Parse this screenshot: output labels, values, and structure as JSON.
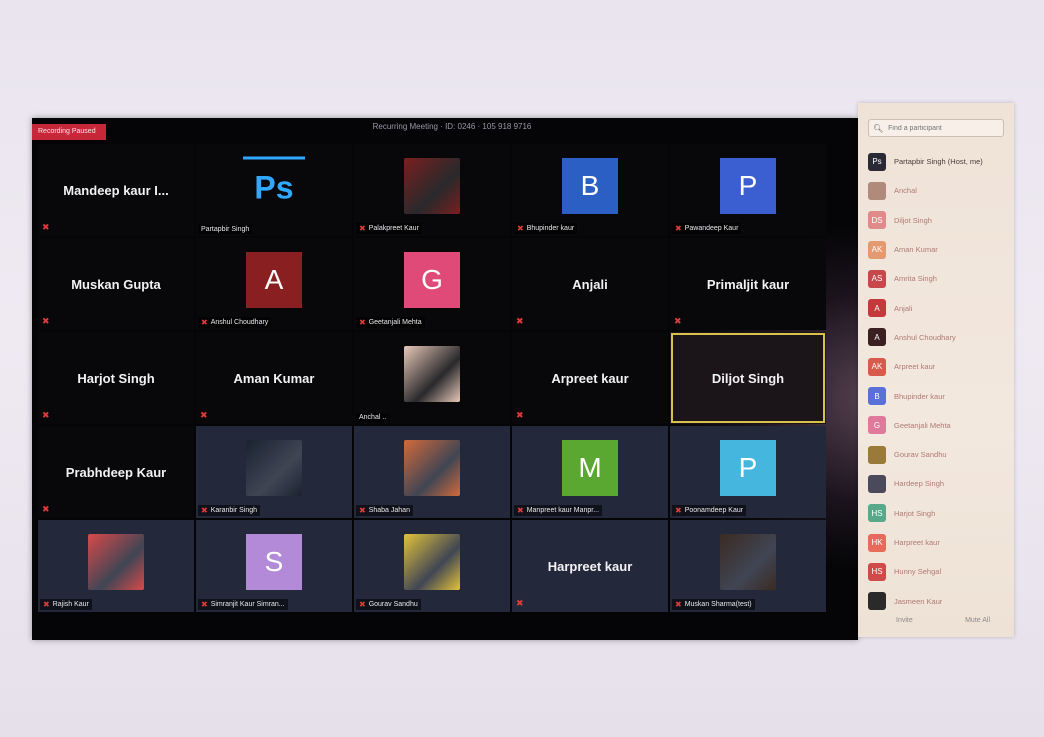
{
  "topbar": {
    "recording": "Recording Paused",
    "meeting_title": "Recurring Meeting · ID: 0246 · 105 918 9716"
  },
  "grid": [
    {
      "style": "dark",
      "center_name": "Mandeep kaur I...",
      "muted": true
    },
    {
      "style": "dark",
      "avatar": {
        "type": "ps",
        "text": "Ps"
      },
      "nameplate": "Partapbir Singh",
      "muted": false
    },
    {
      "style": "dark",
      "avatar": {
        "type": "image",
        "color": "#7a1f1f",
        "icon": "snowy-logo-image"
      },
      "nameplate": "Palakpreet Kaur",
      "muted": true
    },
    {
      "style": "dark",
      "avatar": {
        "type": "letter",
        "text": "B",
        "color": "#2b5fc4"
      },
      "nameplate": "Bhupinder kaur",
      "muted": true
    },
    {
      "style": "dark",
      "avatar": {
        "type": "letter",
        "text": "P",
        "color": "#3b5fd0"
      },
      "nameplate": "Pawandeep Kaur",
      "muted": true
    },
    {
      "style": "dark",
      "center_name": "Muskan Gupta",
      "muted": true
    },
    {
      "style": "dark",
      "avatar": {
        "type": "letter",
        "text": "A",
        "color": "#8a1f22"
      },
      "nameplate": "Anshul Choudhary",
      "muted": true
    },
    {
      "style": "dark",
      "avatar": {
        "type": "letter",
        "text": "G",
        "color": "#e04a78"
      },
      "nameplate": "Geetanjali Mehta",
      "muted": true
    },
    {
      "style": "dark",
      "center_name": "Anjali",
      "muted": true
    },
    {
      "style": "dark",
      "center_name": "Primaljit kaur",
      "muted": true
    },
    {
      "style": "dark",
      "center_name": "Harjot Singh",
      "muted": true
    },
    {
      "style": "dark",
      "center_name": "Aman Kumar",
      "muted": true
    },
    {
      "style": "dark",
      "avatar": {
        "type": "image",
        "color": "#e8c8b8",
        "icon": "baby-photo-image"
      },
      "nameplate": "Anchal ..",
      "muted": false
    },
    {
      "style": "dark",
      "center_name": "Arpreet kaur",
      "muted": true
    },
    {
      "style": "highlight",
      "center_name": "Diljot Singh",
      "muted": false
    },
    {
      "style": "dark",
      "center_name": "Prabhdeep Kaur",
      "muted": true
    },
    {
      "style": "blue",
      "avatar": {
        "type": "image",
        "color": "#1a2230",
        "icon": "dancer-photo-image"
      },
      "nameplate": "Karanbir Singh",
      "muted": true
    },
    {
      "style": "blue",
      "avatar": {
        "type": "image",
        "color": "#d26a3a",
        "icon": "girl-photo-image"
      },
      "nameplate": "Shaba Jahan",
      "muted": true
    },
    {
      "style": "blue",
      "avatar": {
        "type": "letter",
        "text": "M",
        "color": "#5aa832"
      },
      "nameplate": "Manpreet kaur Manpr...",
      "muted": true
    },
    {
      "style": "blue",
      "avatar": {
        "type": "letter",
        "text": "P",
        "color": "#45b7de"
      },
      "nameplate": "Poonamdeep Kaur",
      "muted": true
    },
    {
      "style": "blue",
      "avatar": {
        "type": "image",
        "color": "#d84a4a",
        "icon": "flower-photo-image"
      },
      "nameplate": "Rajish Kaur",
      "muted": true
    },
    {
      "style": "blue",
      "avatar": {
        "type": "letter",
        "text": "S",
        "color": "#b28ad8"
      },
      "nameplate": "Simranjit Kaur Simran...",
      "muted": true
    },
    {
      "style": "blue",
      "avatar": {
        "type": "image",
        "color": "#e3c33a",
        "icon": "portrait-photo-image"
      },
      "nameplate": "Gourav Sandhu",
      "muted": true
    },
    {
      "style": "blue",
      "center_name": "Harpreet kaur",
      "muted": true
    },
    {
      "style": "blue",
      "avatar": {
        "type": "image",
        "color": "#3b2a22",
        "icon": "person-sitting-image"
      },
      "nameplate": "Muskan Sharma(test)",
      "muted": true
    }
  ],
  "panel": {
    "search_placeholder": "Find a participant",
    "participants": [
      {
        "initials": "Ps",
        "name": "Partapbir Singh (Host, me)",
        "color": "#2a2a36",
        "host": true
      },
      {
        "initials": "",
        "name": "Anchal",
        "color": "#b08a7a",
        "host": false
      },
      {
        "initials": "DS",
        "name": "Diljot Singh",
        "color": "#e08a8a",
        "host": false
      },
      {
        "initials": "AK",
        "name": "Aman Kumar",
        "color": "#e49a70",
        "host": false
      },
      {
        "initials": "AS",
        "name": "Amrita Singh",
        "color": "#c7484a",
        "host": false
      },
      {
        "initials": "A",
        "name": "Anjali",
        "color": "#c43a3a",
        "host": false
      },
      {
        "initials": "A",
        "name": "Anshul Choudhary",
        "color": "#3a2020",
        "host": false
      },
      {
        "initials": "AK",
        "name": "Arpreet kaur",
        "color": "#d85a4a",
        "host": false
      },
      {
        "initials": "B",
        "name": "Bhupinder kaur",
        "color": "#5a70d8",
        "host": false
      },
      {
        "initials": "G",
        "name": "Geetanjali Mehta",
        "color": "#e07a9a",
        "host": false
      },
      {
        "initials": "",
        "name": "Gourav Sandhu",
        "color": "#9a7a3a",
        "host": false
      },
      {
        "initials": "",
        "name": "Hardeep Singh",
        "color": "#4a4a5a",
        "host": false
      },
      {
        "initials": "HS",
        "name": "Harjot Singh",
        "color": "#5aa88a",
        "host": false
      },
      {
        "initials": "HK",
        "name": "Harpreet kaur",
        "color": "#e86a5a",
        "host": false
      },
      {
        "initials": "HS",
        "name": "Hunny Sehgal",
        "color": "#d04a4a",
        "host": false
      },
      {
        "initials": "",
        "name": "Jasmeen Kaur",
        "color": "#2a2a2a",
        "host": false
      }
    ],
    "invite_label": "Invite",
    "mute_all_label": "Mute All"
  }
}
